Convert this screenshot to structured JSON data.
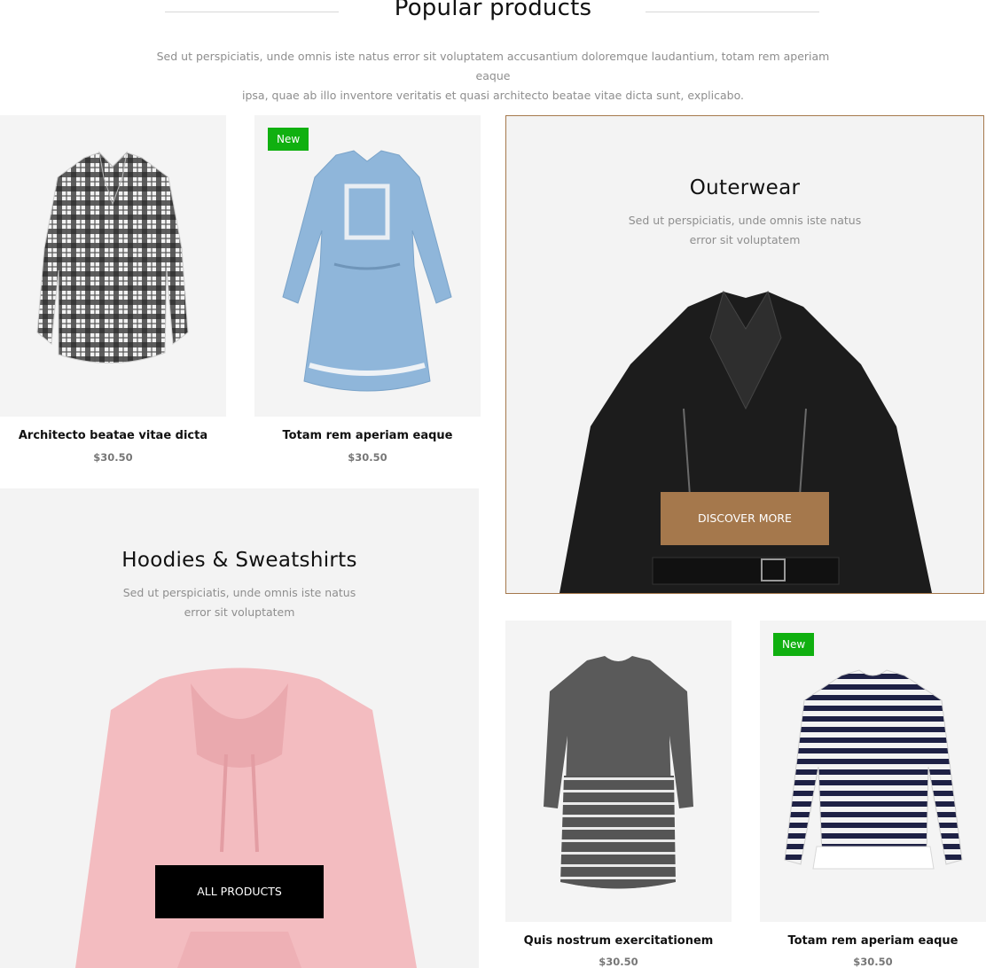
{
  "header": {
    "title": "Popular products",
    "intro_line1": "Sed ut perspiciatis, unde omnis iste natus error sit voluptatem accusantium doloremque laudantium, totam rem aperiam eaque",
    "intro_line2": "ipsa, quae ab illo inventore veritatis et quasi architecto beatae vitae dicta sunt, explicabo."
  },
  "products": [
    {
      "name": "Architecto beatae vitae dicta",
      "price": "$30.50",
      "badge": ""
    },
    {
      "name": "Totam rem aperiam eaque",
      "price": "$30.50",
      "badge": "New"
    },
    {
      "name": "Quis nostrum exercitationem",
      "price": "$30.50",
      "badge": ""
    },
    {
      "name": "Totam rem aperiam eaque",
      "price": "$30.50",
      "badge": "New"
    }
  ],
  "promos": {
    "outerwear": {
      "title": "Outerwear",
      "desc_line1": "Sed ut perspiciatis, unde omnis iste natus",
      "desc_line2": "error sit voluptatem",
      "button": "DISCOVER MORE"
    },
    "hoodies": {
      "title": "Hoodies & Sweatshirts",
      "desc_line1": "Sed ut perspiciatis, unde omnis iste natus",
      "desc_line2": "error sit voluptatem",
      "button": "ALL PRODUCTS"
    }
  },
  "colors": {
    "badge_green": "#10b010",
    "accent_brown": "#a5784c",
    "button_black": "#000000",
    "card_bg": "#f4f4f4"
  }
}
